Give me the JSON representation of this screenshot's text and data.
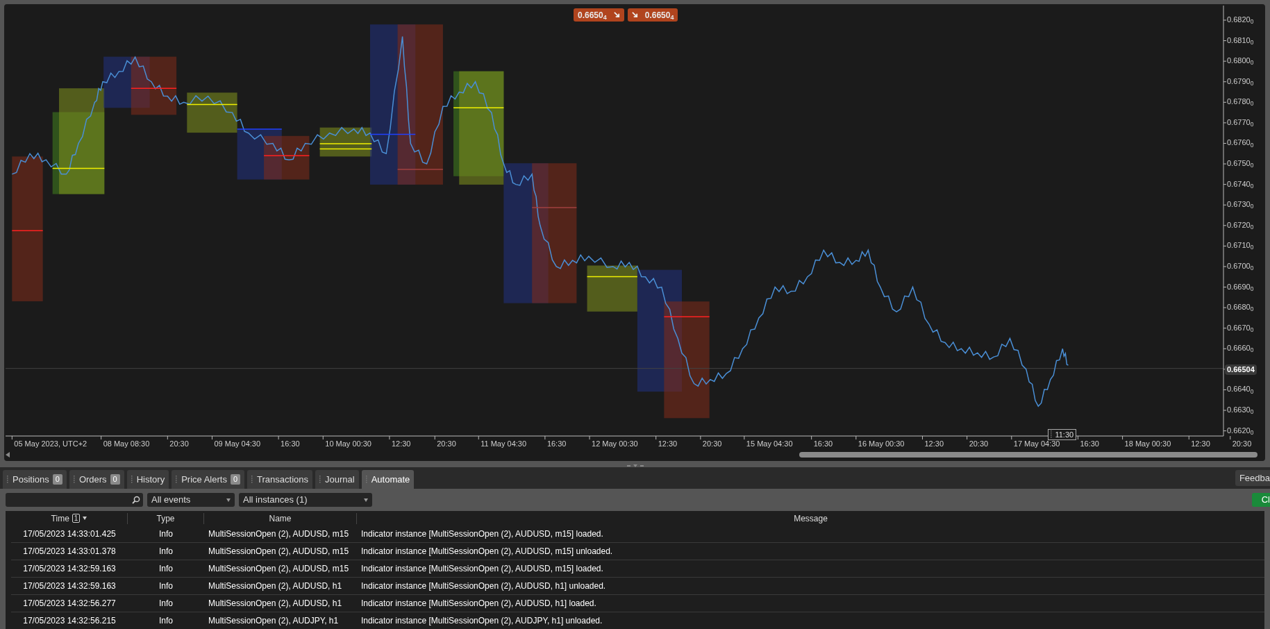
{
  "chart": {
    "quote_buttons": [
      {
        "kind": "sell",
        "label": "0.6650$_{4}$"
      },
      {
        "kind": "buy",
        "label": "0.6650$_{4}$"
      }
    ],
    "y_axis": [
      {
        "kind": "tick",
        "label": "0.6820$_{0}$"
      },
      {
        "kind": "tick",
        "label": "0.6810$_{0}$"
      },
      {
        "kind": "tick",
        "label": "0.6800$_{0}$"
      },
      {
        "kind": "tick",
        "label": "0.6790$_{0}$"
      },
      {
        "kind": "tick",
        "label": "0.6780$_{0}$"
      },
      {
        "kind": "tick",
        "label": "0.6770$_{0}$"
      },
      {
        "kind": "tick",
        "label": "0.6760$_{0}$"
      },
      {
        "kind": "tick",
        "label": "0.6750$_{0}$"
      },
      {
        "kind": "tick",
        "label": "0.6740$_{0}$"
      },
      {
        "kind": "tick",
        "label": "0.6730$_{0}$"
      },
      {
        "kind": "tick",
        "label": "0.6720$_{0}$"
      },
      {
        "kind": "tick",
        "label": "0.6710$_{0}$"
      },
      {
        "kind": "tick",
        "label": "0.6700$_{0}$"
      },
      {
        "kind": "tick",
        "label": "0.6690$_{0}$"
      },
      {
        "kind": "tick",
        "label": "0.6680$_{0}$"
      },
      {
        "kind": "tick",
        "label": "0.6670$_{0}$"
      },
      {
        "kind": "tick",
        "label": "0.6660$_{0}$"
      },
      {
        "kind": "current",
        "label": "0.66504"
      },
      {
        "kind": "tick",
        "label": "0.6640$_{0}$"
      },
      {
        "kind": "tick",
        "label": "0.6630$_{0}$"
      },
      {
        "kind": "tick",
        "label": "0.6620$_{0}$"
      }
    ],
    "x_axis": [
      "05 May 2023, UTC+2",
      "08 May 08:30",
      "20:30",
      "09 May 04:30",
      "16:30",
      "10 May 00:30",
      "12:30",
      "20:30",
      "11 May 04:30",
      "16:30",
      "12 May 00:30",
      "12:30",
      "20:30",
      "15 May 04:30",
      "16:30",
      "16 May 00:30",
      "12:30",
      "20:30",
      "17 May 04:30",
      "16:30",
      "18 May 00:30",
      "12:30",
      "20:30"
    ],
    "cursor_time": "11:30"
  },
  "panel": {
    "tabs": [
      {
        "label": "Positions",
        "count": "0",
        "selected": false
      },
      {
        "label": "Orders",
        "count": "0",
        "selected": false
      },
      {
        "label": "History",
        "selected": false
      },
      {
        "label": "Price Alerts",
        "count": "0",
        "selected": false
      },
      {
        "label": "Transactions",
        "selected": false
      },
      {
        "label": "Journal",
        "selected": false
      },
      {
        "label": "Automate",
        "selected": true
      }
    ],
    "feedback_button": "Feedba",
    "filters": {
      "events": "All events",
      "instances": "All instances (1)"
    },
    "clear_button": "Cl",
    "table": {
      "columns": [
        {
          "label": "Time",
          "sort_badge": "1"
        },
        {
          "label": "Type"
        },
        {
          "label": "Name"
        },
        {
          "label": "Message"
        }
      ],
      "rows": [
        [
          "17/05/2023 14:33:01.425",
          "Info",
          "MultiSessionOpen (2), AUDUSD, m15",
          "Indicator instance [MultiSessionOpen (2), AUDUSD, m15] loaded."
        ],
        [
          "17/05/2023 14:33:01.378",
          "Info",
          "MultiSessionOpen (2), AUDUSD, m15",
          "Indicator instance [MultiSessionOpen (2), AUDUSD, m15] unloaded."
        ],
        [
          "17/05/2023 14:32:59.163",
          "Info",
          "MultiSessionOpen (2), AUDUSD, m15",
          "Indicator instance [MultiSessionOpen (2), AUDUSD, m15] loaded."
        ],
        [
          "17/05/2023 14:32:59.163",
          "Info",
          "MultiSessionOpen (2), AUDUSD, h1",
          "Indicator instance [MultiSessionOpen (2), AUDUSD, h1] unloaded."
        ],
        [
          "17/05/2023 14:32:56.277",
          "Info",
          "MultiSessionOpen (2), AUDUSD, h1",
          "Indicator instance [MultiSessionOpen (2), AUDUSD, h1] loaded."
        ],
        [
          "17/05/2023 14:32:56.215",
          "Info",
          "MultiSessionOpen (2), AUDJPY, h1",
          "Indicator instance [MultiSessionOpen (2), AUDJPY, h1] unloaded."
        ]
      ]
    }
  }
}
